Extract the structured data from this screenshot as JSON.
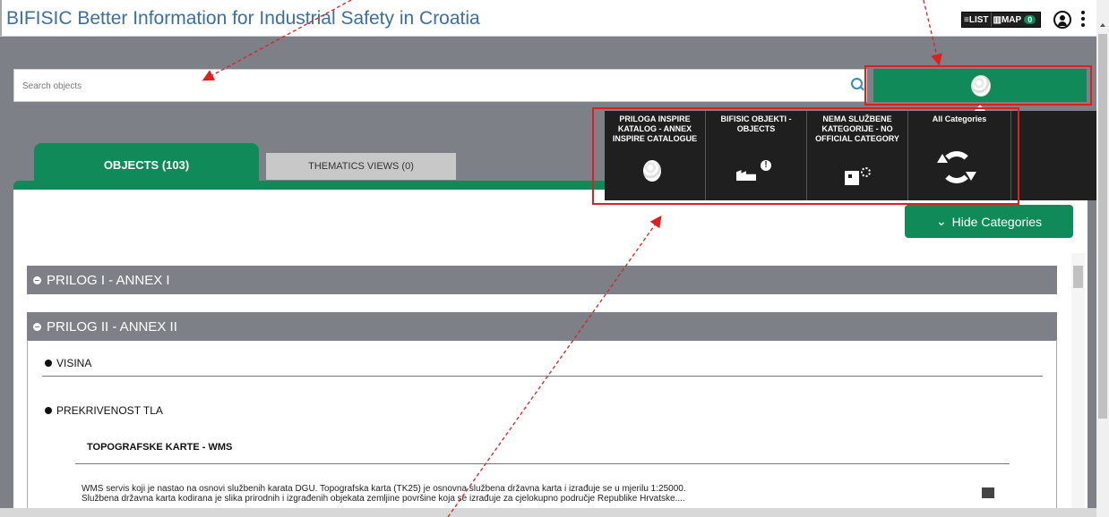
{
  "header": {
    "title": "BIFISIC Better Information for Industrial Safety in Croatia",
    "list_label": "LIST",
    "map_label": "MAP",
    "map_count": "0"
  },
  "search": {
    "placeholder": "Search objects"
  },
  "categories_dropdown": {
    "items": [
      {
        "label": "PRILOGA INSPIRE KATALOG - ANNEX INSPIRE CATALOGUE",
        "icon": "globe-icon"
      },
      {
        "label": "BIFISIC OBJEKTI - OBJECTS",
        "icon": "factory-alert-icon"
      },
      {
        "label": "NEMA SLUŽBENE KATEGORIJE - NO OFFICIAL CATEGORY",
        "icon": "box-gear-icon"
      },
      {
        "label": "All Categories",
        "icon": "recycle-icon"
      }
    ]
  },
  "tabs": [
    {
      "label": "OBJECTS (103)",
      "active": true
    },
    {
      "label": "THEMATICS VIEWS (0)",
      "active": false
    }
  ],
  "hide_categories_label": "Hide Categories",
  "annexes": [
    {
      "label": "PRILOG I - ANNEX I",
      "expanded": false
    },
    {
      "label": "PRILOG II - ANNEX II",
      "expanded": true
    }
  ],
  "subcategories": [
    {
      "label": "VISINA",
      "expanded": false
    },
    {
      "label": "PREKRIVENOST TLA",
      "expanded": true
    }
  ],
  "wms": {
    "title": "TOPOGRAFSKE KARTE - WMS",
    "desc_line1": "WMS servis koji je nastao na osnovi službenih karata DGU. Topografska karta (TK25) je osnovna službena državna karta i izrađuje se u mjerilu 1:25000.",
    "desc_line2": "Službena državna karta kodirana je slika prirodnih i izgrađenih objekata zemljine površine koja se izrađuje za cjelokupno područje Republike Hrvatske...."
  },
  "colors": {
    "accent": "#108a58",
    "annotation": "#e01e1e",
    "dropdown_bg": "#1f1f1f"
  }
}
